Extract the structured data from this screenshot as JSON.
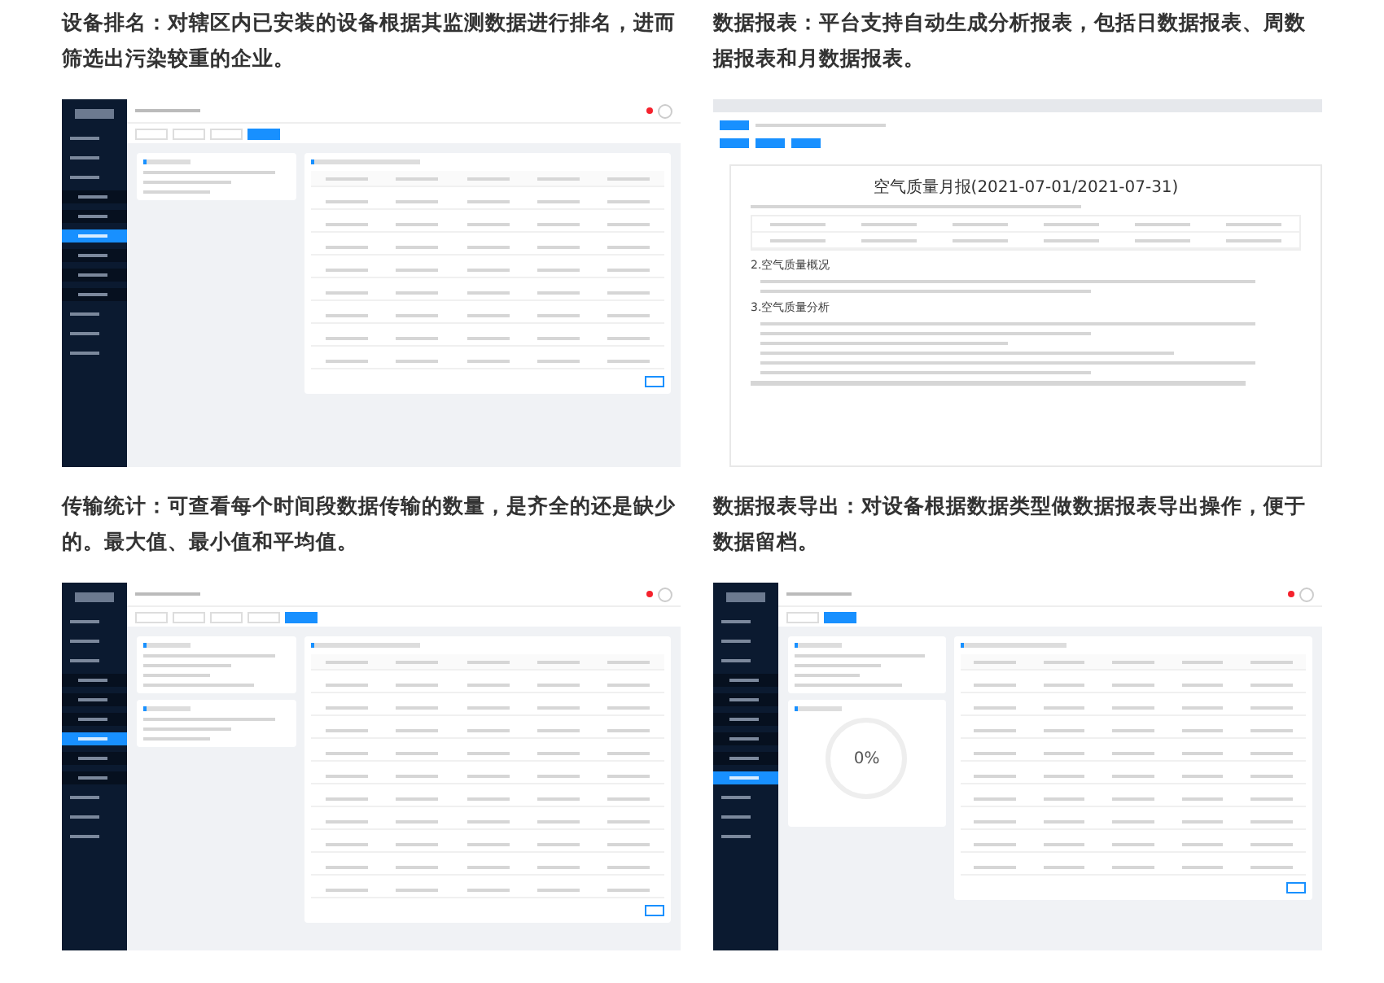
{
  "features": [
    {
      "heading": "设备排名：对辖区内已安装的设备根据其监测数据进行排名，进而筛选出污染较重的企业。",
      "screenshot": {
        "kind": "ranking",
        "menu_items": [
          {
            "kind": "top",
            "selected": false
          },
          {
            "kind": "top",
            "selected": false
          },
          {
            "kind": "top",
            "selected": false
          },
          {
            "kind": "sub",
            "selected": false
          },
          {
            "kind": "sub",
            "selected": false
          },
          {
            "kind": "sub",
            "selected": true
          },
          {
            "kind": "sub",
            "selected": false
          },
          {
            "kind": "sub",
            "selected": false
          },
          {
            "kind": "sub",
            "selected": false
          },
          {
            "kind": "top",
            "selected": false
          },
          {
            "kind": "top",
            "selected": false
          },
          {
            "kind": "top",
            "selected": false
          }
        ],
        "tabs": [
          {
            "selected": false
          },
          {
            "selected": false
          },
          {
            "selected": false
          },
          {
            "selected": true
          }
        ]
      }
    },
    {
      "heading": "数据报表：平台支持自动生成分析报表，包括日数据报表、周数据报表和月数据报表。",
      "screenshot": {
        "kind": "report",
        "title": "空气质量月报(2021-07-01/2021-07-31)",
        "sections": [
          "2.空气质量概况",
          "3.空气质量分析"
        ]
      }
    },
    {
      "heading": "传输统计：可查看每个时间段数据传输的数量，是齐全的还是缺少的。最大值、最小值和平均值。",
      "screenshot": {
        "kind": "transfer",
        "menu_items": [
          {
            "kind": "top",
            "selected": false
          },
          {
            "kind": "top",
            "selected": false
          },
          {
            "kind": "top",
            "selected": false
          },
          {
            "kind": "sub",
            "selected": false
          },
          {
            "kind": "sub",
            "selected": false
          },
          {
            "kind": "sub",
            "selected": false
          },
          {
            "kind": "sub",
            "selected": true
          },
          {
            "kind": "sub",
            "selected": false
          },
          {
            "kind": "sub",
            "selected": false
          },
          {
            "kind": "top",
            "selected": false
          },
          {
            "kind": "top",
            "selected": false
          },
          {
            "kind": "top",
            "selected": false
          }
        ],
        "tabs": [
          {
            "selected": false
          },
          {
            "selected": false
          },
          {
            "selected": false
          },
          {
            "selected": false
          },
          {
            "selected": true
          }
        ]
      }
    },
    {
      "heading": "数据报表导出：对设备根据数据类型做数据报表导出操作，便于数据留档。",
      "screenshot": {
        "kind": "export",
        "progress": "0%",
        "menu_items": [
          {
            "kind": "top",
            "selected": false
          },
          {
            "kind": "top",
            "selected": false
          },
          {
            "kind": "top",
            "selected": false
          },
          {
            "kind": "sub",
            "selected": false
          },
          {
            "kind": "sub",
            "selected": false
          },
          {
            "kind": "sub",
            "selected": false
          },
          {
            "kind": "sub",
            "selected": false
          },
          {
            "kind": "sub",
            "selected": false
          },
          {
            "kind": "sub",
            "selected": true
          },
          {
            "kind": "top",
            "selected": false
          },
          {
            "kind": "top",
            "selected": false
          },
          {
            "kind": "top",
            "selected": false
          }
        ],
        "tabs": [
          {
            "selected": false
          },
          {
            "selected": true
          }
        ]
      }
    }
  ]
}
